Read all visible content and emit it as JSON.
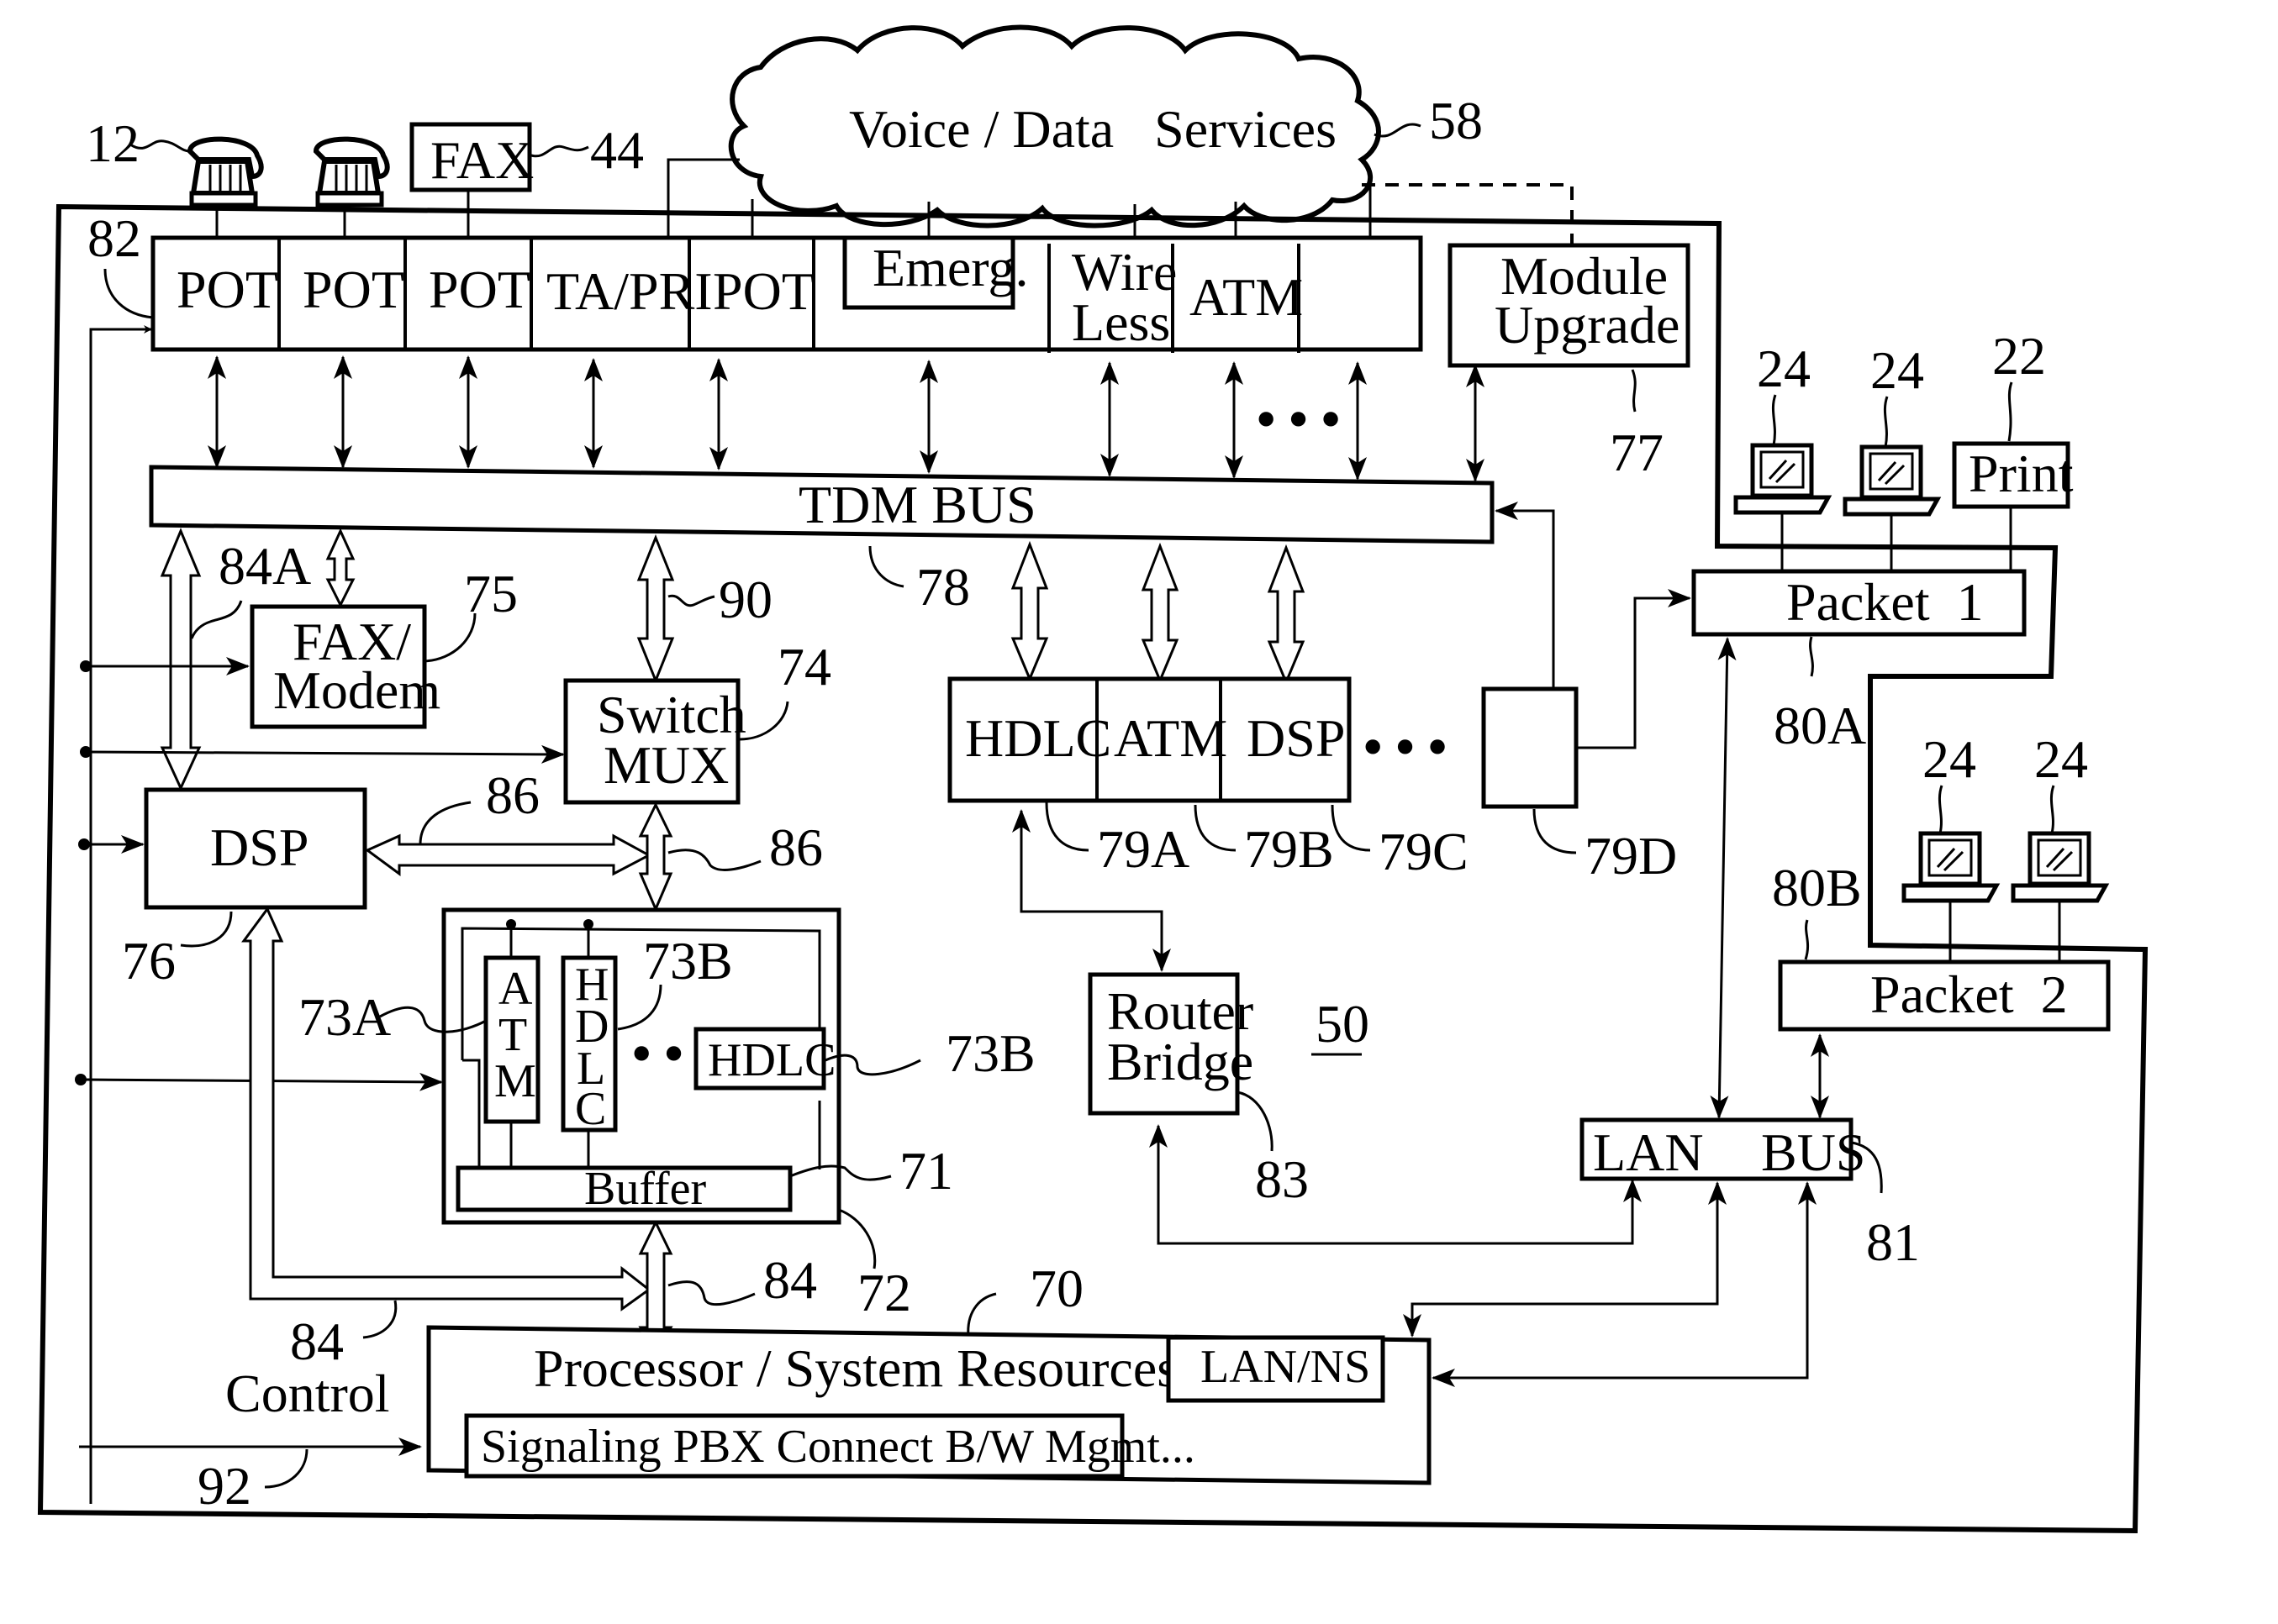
{
  "diagram": {
    "cloud": {
      "label": "Voice / Data   Services",
      "ref": "58"
    },
    "devices": {
      "phone_ref": "12",
      "fax_label": "FAX",
      "fax_ref": "44"
    },
    "system_ref": "50",
    "module_row": {
      "ref": "82",
      "modules": [
        "POT",
        "POT",
        "POT",
        "TA/PRI",
        "POT",
        "Emerg.",
        "Wire Less",
        "ATM",
        ""
      ],
      "wireless_line1": "Wire",
      "wireless_line2": "Less",
      "ellipsis": "• • •"
    },
    "module_upgrade": {
      "line1": "Module",
      "line2": "Upgrade",
      "ref": "77"
    },
    "tdm_bus": {
      "label": "TDM BUS",
      "ref": "78"
    },
    "fax_modem": {
      "line1": "FAX/",
      "line2": "Modem",
      "ref": "75"
    },
    "switch_mux": {
      "line1": "Switch",
      "line2": "MUX",
      "ref": "74"
    },
    "dsp": {
      "label": "DSP",
      "ref": "76"
    },
    "bus_refs": {
      "b84a": "84A",
      "b90": "90",
      "b86a": "86",
      "b86b": "86",
      "b84b": "84",
      "b84c": "84"
    },
    "packet_modules": {
      "items": [
        "HDLC",
        "ATM",
        "DSP"
      ],
      "refs": [
        "79A",
        "79B",
        "79C",
        "79D"
      ],
      "ellipsis": "• • •"
    },
    "router_bridge": {
      "line1": "Router",
      "line2": "Bridge",
      "ref": "83"
    },
    "cell_block": {
      "atm_letters": [
        "A",
        "T",
        "M"
      ],
      "hdlc_letters": [
        "H",
        "D",
        "L",
        "C"
      ],
      "hdlc_box": "HDLC",
      "buffer": "Buffer",
      "ref_73a": "73A",
      "ref_73b_1": "73B",
      "ref_73b_2": "73B",
      "ref_71": "71",
      "ref_72": "72",
      "dots": "• •"
    },
    "processor": {
      "label": "Processor / System Resources",
      "ref": "70",
      "sub": "Signaling PBX Connect B/W Mgmt...",
      "lanns": "LAN/NS"
    },
    "control": {
      "label": "Control",
      "ref": "92"
    },
    "lan_bus": {
      "left": "LAN",
      "right": "BUS",
      "ref": "81"
    },
    "packet1": {
      "label": "Packet  1",
      "ref": "80A"
    },
    "packet2": {
      "label": "Packet  2",
      "ref": "80B"
    },
    "workstation_ref": "24",
    "printer": {
      "label": "Print",
      "ref": "22"
    }
  }
}
